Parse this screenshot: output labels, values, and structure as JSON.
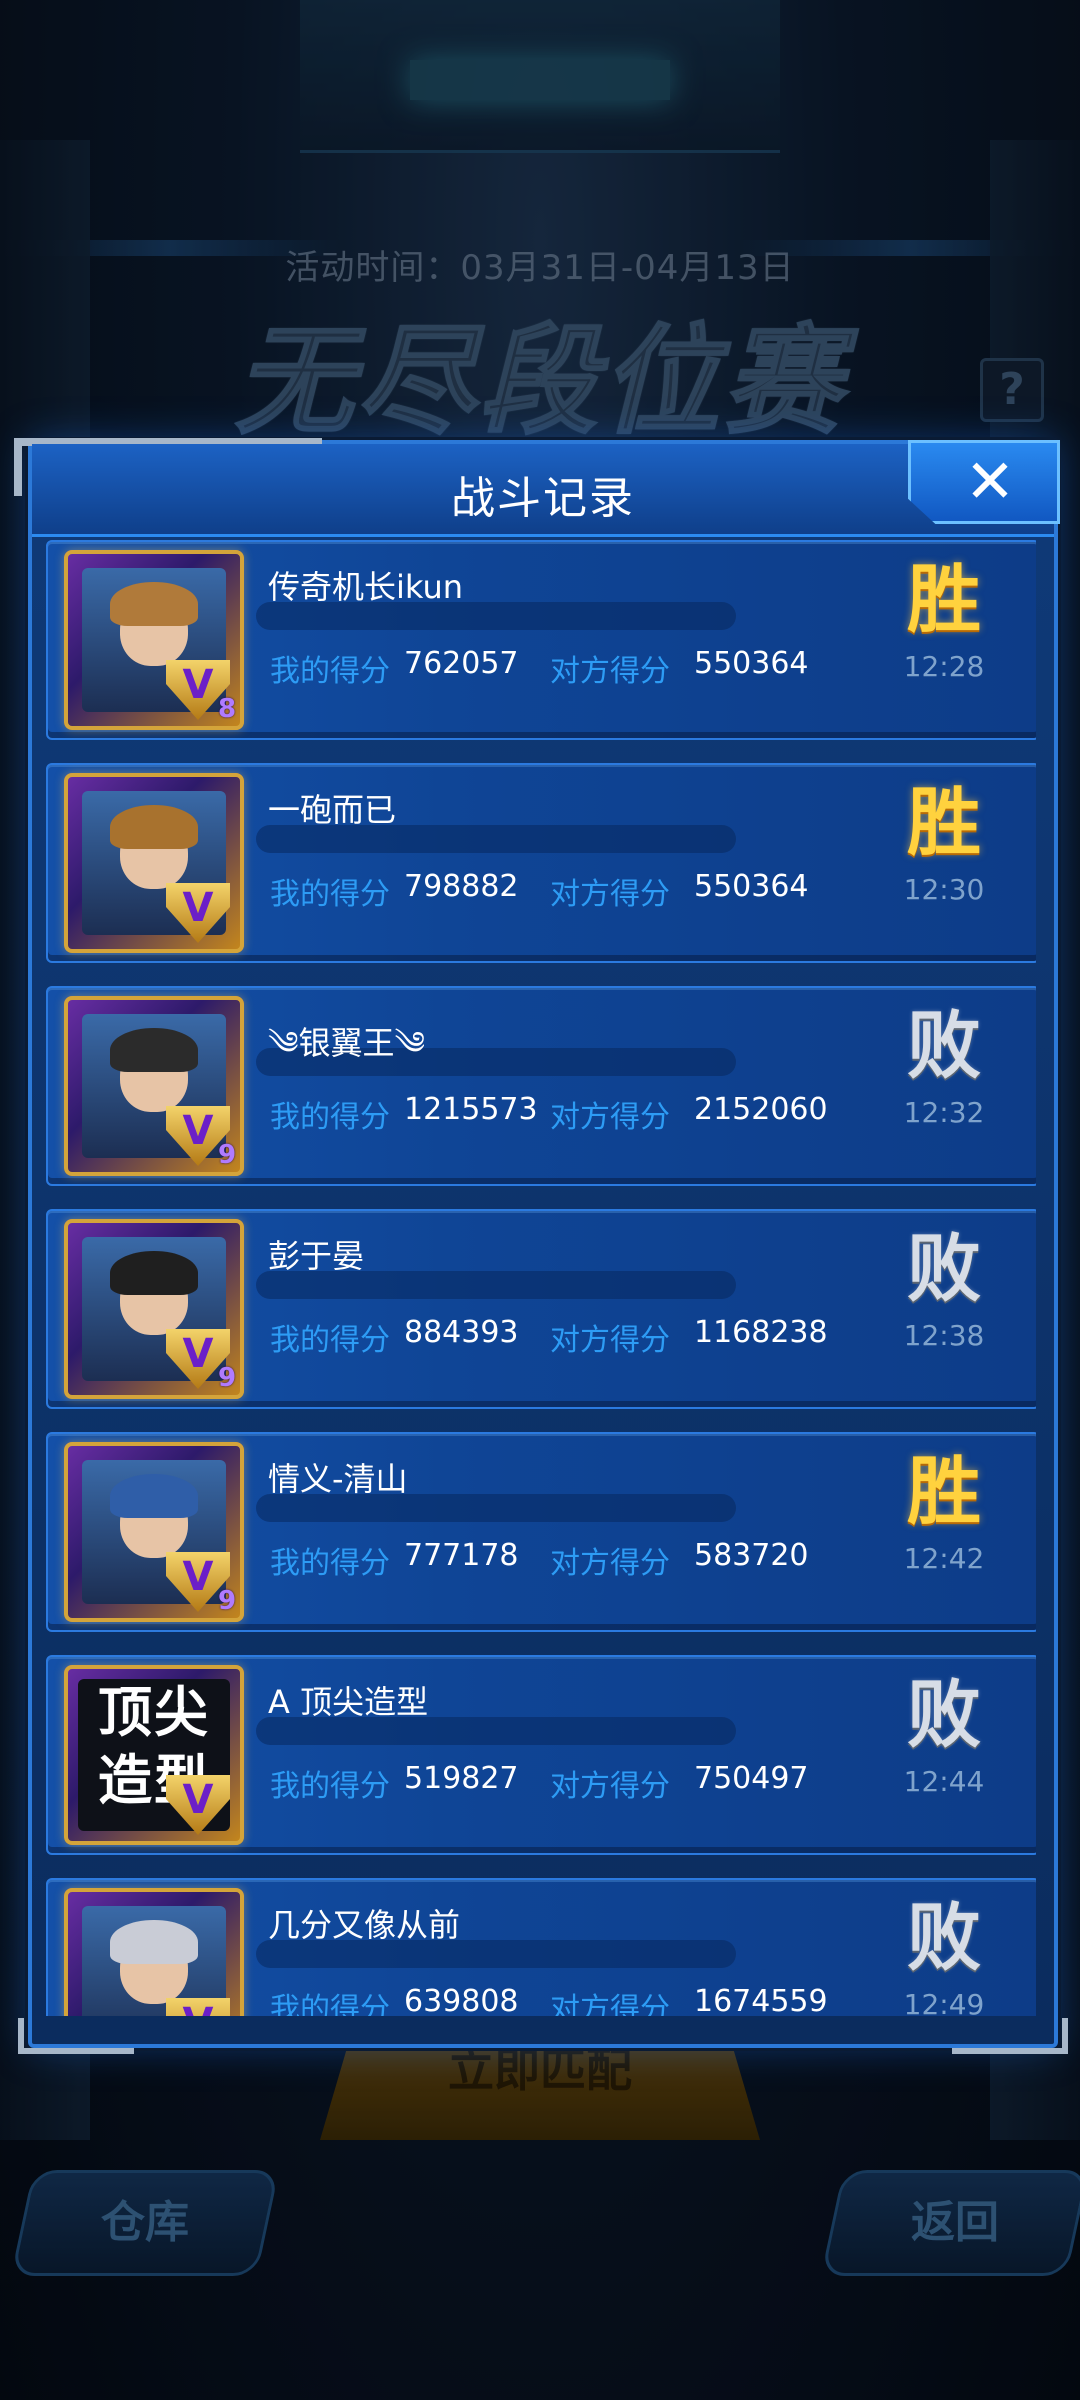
{
  "event": {
    "time_text": "活动时间：03月31日-04月13日",
    "title": "无尽段位赛",
    "help": "?"
  },
  "background_buttons": {
    "match": "立即匹配",
    "warehouse": "仓库",
    "back": "返回"
  },
  "modal": {
    "title": "战斗记录",
    "close_icon": "✕"
  },
  "labels": {
    "my_score": "我的得分",
    "opp_score": "对方得分"
  },
  "records": [
    {
      "name": "传奇机长ikun",
      "my_score": "762057",
      "opp_score": "550364",
      "result": "胜",
      "outcome": "win",
      "time": "12:28",
      "rank_level": "8",
      "hair": "#b07a3a"
    },
    {
      "name": "一砲而已",
      "my_score": "798882",
      "opp_score": "550364",
      "result": "胜",
      "outcome": "win",
      "time": "12:30",
      "rank_level": "",
      "hair": "#a8722e"
    },
    {
      "name": "༄银翼王༄",
      "my_score": "1215573",
      "opp_score": "2152060",
      "result": "败",
      "outcome": "loss",
      "time": "12:32",
      "rank_level": "9",
      "hair": "#2b2b2b"
    },
    {
      "name": "彭于晏",
      "my_score": "884393",
      "opp_score": "1168238",
      "result": "败",
      "outcome": "loss",
      "time": "12:38",
      "rank_level": "9",
      "hair": "#1f1f1f"
    },
    {
      "name": "情义-清山",
      "my_score": "777178",
      "opp_score": "583720",
      "result": "胜",
      "outcome": "win",
      "time": "12:42",
      "rank_level": "9",
      "hair": "#2f5ea8"
    },
    {
      "name": "A 顶尖造型",
      "my_score": "519827",
      "opp_score": "750497",
      "result": "败",
      "outcome": "loss",
      "time": "12:44",
      "rank_level": "",
      "avatar_text": "顶尖造型",
      "hair": "#000000"
    },
    {
      "name": "几分又像从前",
      "my_score": "639808",
      "opp_score": "1674559",
      "result": "败",
      "outcome": "loss",
      "time": "12:49",
      "rank_level": "",
      "hair": "#c9ccd6"
    }
  ],
  "colors": {
    "win": "#ffd23e",
    "loss": "#d7dde6",
    "score_label": "#2d9cf5",
    "panel": "#0f3a78"
  }
}
